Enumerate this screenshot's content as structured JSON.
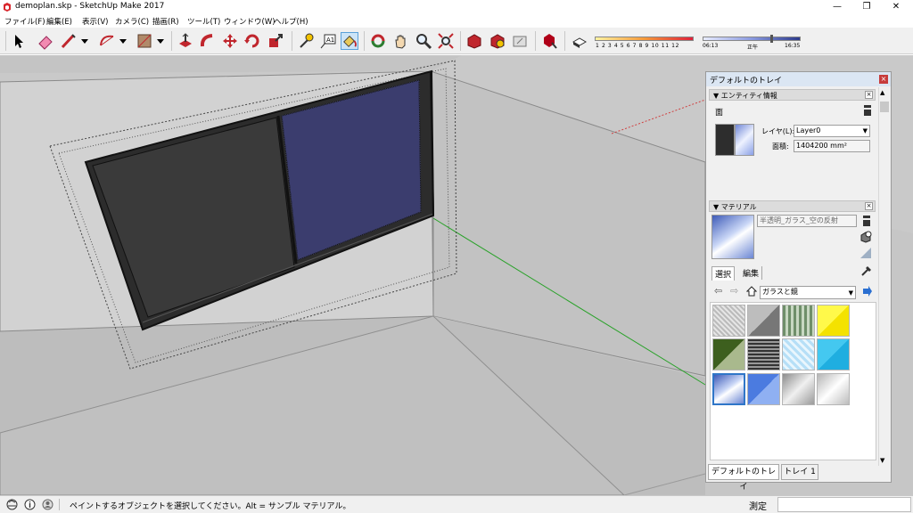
{
  "window": {
    "title": "demoplan.skp - SketchUp Make 2017",
    "minimize": "—",
    "maximize": "❐",
    "close": "✕"
  },
  "menu": [
    "ファイル(F)",
    "編集(E)",
    "表示(V)",
    "カメラ(C)",
    "描画(R)",
    "ツール(T)",
    "ウィンドウ(W)",
    "ヘルプ(H)"
  ],
  "toolbar": {
    "active_tool": "paint-bucket",
    "shadow_scale": [
      "1",
      "2",
      "3",
      "4",
      "5",
      "6",
      "7",
      "8",
      "9",
      "10",
      "11",
      "12"
    ],
    "time_start": "06:13",
    "time_mid": "正午",
    "time_end": "16:35",
    "colors": {
      "shadow_gradient_start": "#fff3a0",
      "shadow_gradient_end": "#e0203a",
      "time_bar": "#2c3a8c"
    }
  },
  "tray": {
    "title": "デフォルトのトレイ",
    "entity_info": {
      "header": "エンティティ情報",
      "entity_type": "面",
      "layer_label": "レイヤ(L):",
      "layer_value": "Layer0",
      "area_label": "面積:",
      "area_value": "1404200 mm²"
    },
    "materials": {
      "header": "マテリアル",
      "material_name": "半透明_ガラス_空の反射",
      "tab_select": "選択",
      "tab_edit": "編集",
      "library": "ガラスと鏡"
    },
    "tabs": [
      "デフォルトのトレイ",
      "トレイ 1"
    ]
  },
  "status": {
    "message": "ペイントするオブジェクトを選択してください。Alt = サンプル マテリアル。",
    "measure_label": "測定",
    "measure_value": ""
  }
}
